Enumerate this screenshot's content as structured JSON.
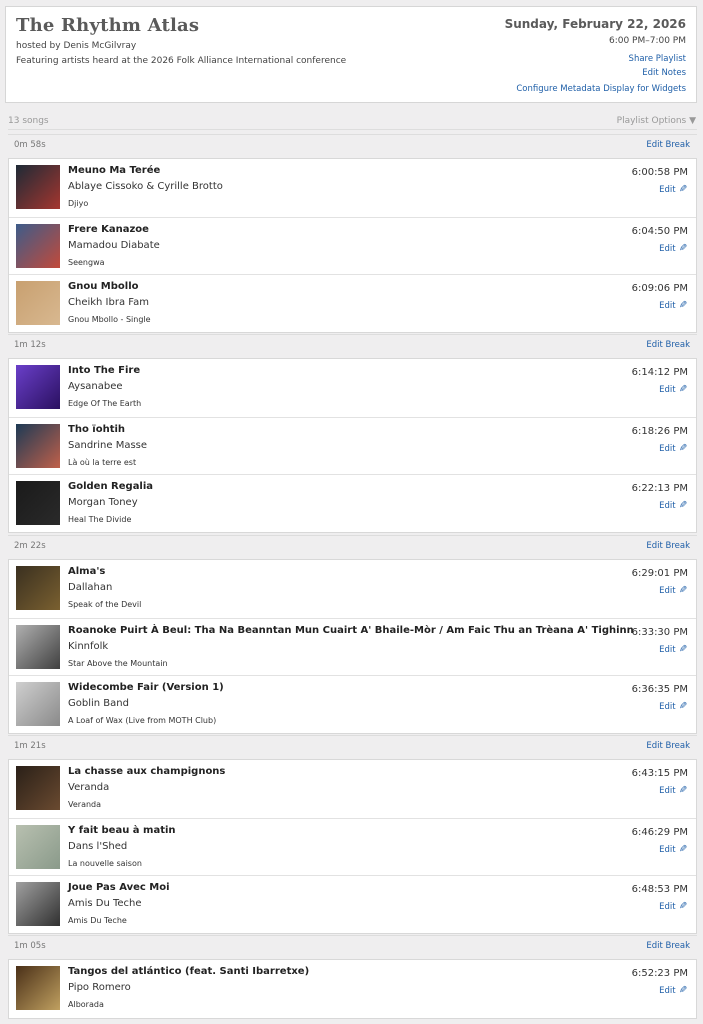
{
  "show": {
    "title": "The Rhythm Atlas",
    "hosted_by": "hosted by Denis McGilvray",
    "featuring": "Featuring artists heard at the 2026 Folk Alliance International conference",
    "date": "Sunday, February 22, 2026",
    "time": "6:00 PM–7:00 PM",
    "share_label": "Share Playlist",
    "notes_label": "Edit Notes",
    "metadata_label": "Configure Metadata Display for Widgets"
  },
  "playlist": {
    "song_count": "13 songs",
    "options_label": "Playlist Options ▼",
    "edit_break_label": "Edit Break",
    "edit_label": "Edit",
    "edit_icon": "pencil-icon",
    "breaks": [
      "0m 58s",
      "1m 12s",
      "2m 22s",
      "1m 21s",
      "1m 05s"
    ],
    "songs": [
      {
        "title": "Meuno Ma Terée",
        "artist": "Ablaye Cissoko & Cyrille Brotto",
        "album": "Djiyo",
        "time": "6:00:58 PM"
      },
      {
        "title": "Frere Kanazoe",
        "artist": "Mamadou Diabate",
        "album": "Seengwa",
        "time": "6:04:50 PM"
      },
      {
        "title": "Gnou Mbollo",
        "artist": "Cheikh Ibra Fam",
        "album": "Gnou Mbollo - Single",
        "time": "6:09:06 PM"
      },
      {
        "title": "Into The Fire",
        "artist": "Aysanabee",
        "album": "Edge Of The Earth",
        "time": "6:14:12 PM"
      },
      {
        "title": "Tho ïohtih",
        "artist": "Sandrine Masse",
        "album": "Là où la terre est",
        "time": "6:18:26 PM"
      },
      {
        "title": "Golden Regalia",
        "artist": "Morgan Toney",
        "album": "Heal The Divide",
        "time": "6:22:13 PM"
      },
      {
        "title": "Alma's",
        "artist": "Dallahan",
        "album": "Speak of the Devil",
        "time": "6:29:01 PM"
      },
      {
        "title": "Roanoke Puirt À Beul: Tha Na Beanntan Mun Cuairt A' Bhaile-Mòr / Am Faic Thu an Trèana A' Tighinn",
        "artist": "Kinnfolk",
        "album": "Star Above the Mountain",
        "time": "6:33:30 PM"
      },
      {
        "title": "Widecombe Fair (Version 1)",
        "artist": "Goblin Band",
        "album": "A Loaf of Wax (Live from MOTH Club)",
        "time": "6:36:35 PM"
      },
      {
        "title": "La chasse aux champignons",
        "artist": "Veranda",
        "album": "Veranda",
        "time": "6:43:15 PM"
      },
      {
        "title": "Y fait beau à matin",
        "artist": "Dans l'Shed",
        "album": "La nouvelle saison",
        "time": "6:46:29 PM"
      },
      {
        "title": "Joue Pas Avec Moi",
        "artist": "Amis Du Teche",
        "album": "Amis Du Teche",
        "time": "6:48:53 PM"
      },
      {
        "title": "Tangos del atlántico (feat. Santi Ibarretxe)",
        "artist": "Pipo Romero",
        "album": "Alborada",
        "time": "6:52:23 PM"
      }
    ]
  },
  "colors": {
    "background": "#efeeef",
    "link": "#1f5fa8",
    "title_gray": "#5a5a5a",
    "art": [
      [
        "#1e2a36",
        "#a5362f"
      ],
      [
        "#3d5c8a",
        "#c24a3a"
      ],
      [
        "#c8a070",
        "#d8b890"
      ],
      [
        "#6a3fc9",
        "#2a1060"
      ],
      [
        "#1d3a55",
        "#c0604a"
      ],
      [
        "#1a1a1a",
        "#2a2a2a"
      ],
      [
        "#3a3020",
        "#7a6030"
      ],
      [
        "#b0b0b0",
        "#404040"
      ],
      [
        "#cfcfcf",
        "#8a8a8a"
      ],
      [
        "#2a2018",
        "#6a4a30"
      ],
      [
        "#b8c0b0",
        "#8a9a8a"
      ],
      [
        "#a0a0a0",
        "#303030"
      ],
      [
        "#4a3018",
        "#c0a060"
      ]
    ]
  }
}
